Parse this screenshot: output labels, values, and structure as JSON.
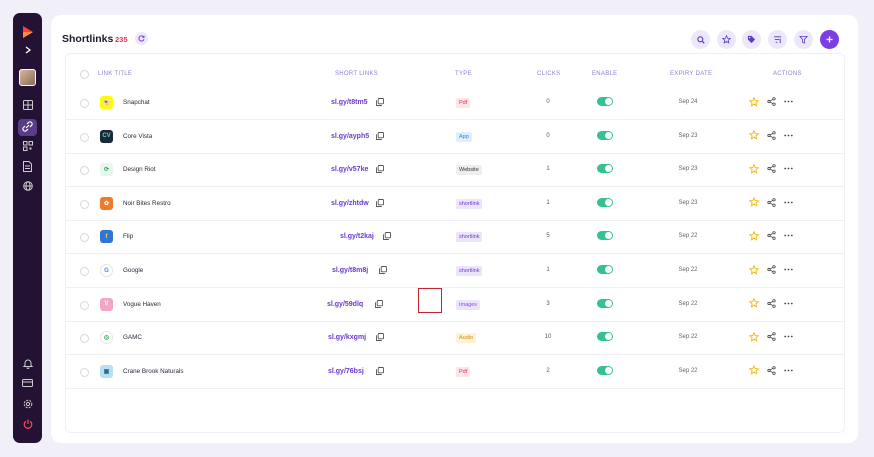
{
  "header": {
    "title": "Shortlinks",
    "count": "235"
  },
  "columns": {
    "link_title": "LINK TITLE",
    "short_links": "SHORT LINKS",
    "type": "TYPE",
    "clicks": "CLICKS",
    "enable": "ENABLE",
    "expiry_date": "EXPIRY DATE",
    "actions": "ACTIONS"
  },
  "rows": [
    {
      "title": "Snapchat",
      "short": "sl.gy/t8tm5",
      "type": "Pdf",
      "clicks": "0",
      "enabled": true,
      "expiry": "Sep 24",
      "logo": "snapchat-logo"
    },
    {
      "title": "Core Vista",
      "short": "sl.gy/ayph5",
      "type": "App",
      "clicks": "0",
      "enabled": true,
      "expiry": "Sep 23",
      "logo": "core-vista-logo"
    },
    {
      "title": "Design Riot",
      "short": "sl.gy/v57ke",
      "type": "Website",
      "clicks": "1",
      "enabled": true,
      "expiry": "Sep 23",
      "logo": "design-riot-logo"
    },
    {
      "title": "Noir Bites Restro",
      "short": "sl.gy/zhtdw",
      "type": "shortlink",
      "clicks": "1",
      "enabled": true,
      "expiry": "Sep 23",
      "logo": "noir-bites-logo"
    },
    {
      "title": "Flip",
      "short": "sl.gy/t2kaj",
      "type": "shortlink",
      "clicks": "5",
      "enabled": true,
      "expiry": "Sep 22",
      "logo": "flip-logo"
    },
    {
      "title": "Google",
      "short": "sl.gy/t8m8j",
      "type": "shortlink",
      "clicks": "1",
      "enabled": true,
      "expiry": "Sep 22",
      "logo": "google-logo"
    },
    {
      "title": "Vogue Haven",
      "short": "sl.gy/59dlq",
      "type": "Images",
      "clicks": "3",
      "enabled": true,
      "expiry": "Sep 22",
      "logo": "vogue-haven-logo"
    },
    {
      "title": "GAMC",
      "short": "sl.gy/kxgmj",
      "type": "Audio",
      "clicks": "10",
      "enabled": true,
      "expiry": "Sep 22",
      "logo": "gamc-logo"
    },
    {
      "title": "Crane Brook Naturals",
      "short": "sl.gy/76bsj",
      "type": "Pdf",
      "clicks": "2",
      "enabled": true,
      "expiry": "Sep 22",
      "logo": "crane-brook-logo"
    }
  ],
  "type_colors": {
    "Pdf": {
      "bg": "#fde4e8",
      "fg": "#e0315a"
    },
    "App": {
      "bg": "#ddeefe",
      "fg": "#2f7fd9"
    },
    "Website": {
      "bg": "#eeeeee",
      "fg": "#333333"
    },
    "shortlink": {
      "bg": "#ece4fb",
      "fg": "#6a3ad0"
    },
    "Images": {
      "bg": "#ece4fb",
      "fg": "#8a4fe0"
    },
    "Audio": {
      "bg": "#fff1d6",
      "fg": "#d98a00"
    }
  },
  "colors": {
    "accent": "#7b3fe4",
    "sidebar": "#231234",
    "toggle_on": "#34c38f",
    "star": "#f2b705"
  },
  "toolbar_icons": [
    "search-icon",
    "star-icon",
    "tag-icon",
    "sort-icon",
    "filter-icon",
    "plus-icon"
  ],
  "sidebar_icons": [
    "logo-icon",
    "expand-icon",
    "avatar",
    "dashboard-icon",
    "link-icon",
    "qr-icon",
    "document-icon",
    "globe-icon",
    "bell-icon",
    "card-icon",
    "settings-icon",
    "power-icon"
  ]
}
